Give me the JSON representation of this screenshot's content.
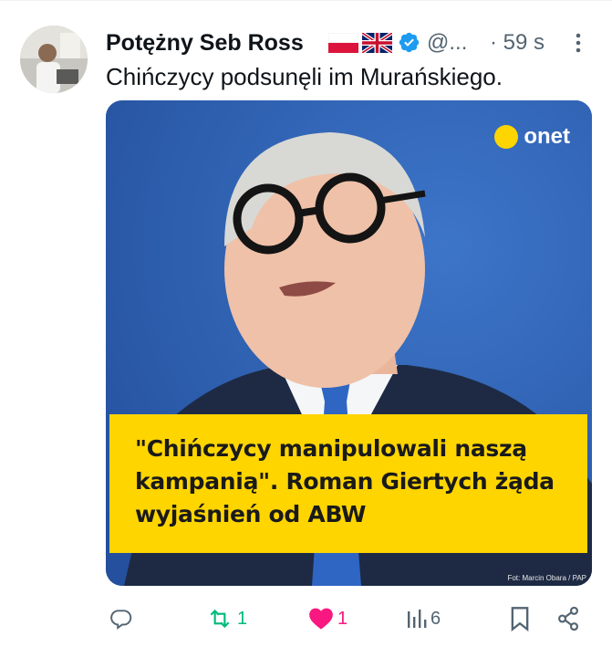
{
  "tweet": {
    "display_name": "Potężny Seb Ross",
    "flags": [
      "🇵🇱",
      "🇬🇧"
    ],
    "handle": "@...",
    "time": "· 59 s",
    "text": "Chińczycy podsunęli im Murańskiego."
  },
  "media": {
    "brand": "onet",
    "headline": "\"Chińczycy manipulowali naszą kampanią\". Roman Giertych żąda wyjaśnień od ABW",
    "photo_credit": "Fot: Marcin Obara / PAP"
  },
  "actions": {
    "reply_count": "",
    "retweet_count": "1",
    "like_count": "1",
    "views_count": "6"
  },
  "colors": {
    "retweet": "#00ba7c",
    "like": "#f91880",
    "verified": "#1d9bf0",
    "muted": "#536471",
    "brand_yellow": "#ffd500",
    "image_background": "#2f63b9"
  }
}
